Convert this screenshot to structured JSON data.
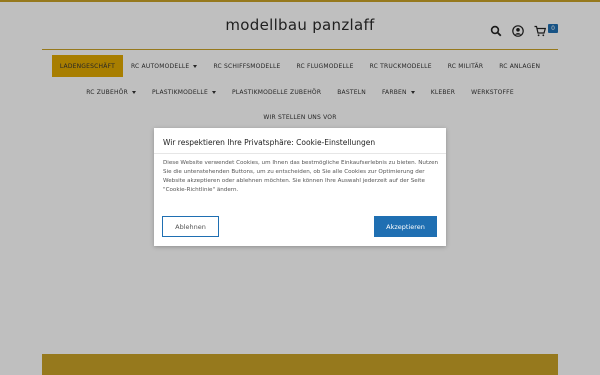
{
  "header": {
    "logo": "modellbau panzlaff",
    "cart_count": "0"
  },
  "icons": {
    "search": "search-icon",
    "account": "account-icon",
    "cart": "cart-icon"
  },
  "colors": {
    "gold": "#c9a227",
    "active_tab": "#e0a900",
    "primary_blue": "#1f6fb2"
  },
  "nav": {
    "row1": [
      {
        "label": "LADENGESCHÄFT",
        "active": true,
        "dropdown": false
      },
      {
        "label": "RC AUTOMODELLE",
        "active": false,
        "dropdown": true
      },
      {
        "label": "RC SCHIFFSMODELLE",
        "active": false,
        "dropdown": false
      },
      {
        "label": "RC FLUGMODELLE",
        "active": false,
        "dropdown": false
      },
      {
        "label": "RC TRUCKMODELLE",
        "active": false,
        "dropdown": false
      },
      {
        "label": "RC MILITÄR",
        "active": false,
        "dropdown": false
      },
      {
        "label": "RC ANLAGEN",
        "active": false,
        "dropdown": false
      }
    ],
    "row2": [
      {
        "label": "RC ZUBEHÖR",
        "dropdown": true
      },
      {
        "label": "PLASTIKMODELLE",
        "dropdown": true
      },
      {
        "label": "PLASTIKMODELLE ZUBEHÖR",
        "dropdown": false
      },
      {
        "label": "BASTELN",
        "dropdown": false
      },
      {
        "label": "FARBEN",
        "dropdown": true
      },
      {
        "label": "KLEBER",
        "dropdown": false
      },
      {
        "label": "WERKSTOFFE",
        "dropdown": false
      }
    ],
    "row3": [
      {
        "label": "WIR STELLEN UNS VOR"
      }
    ]
  },
  "cookie_modal": {
    "title": "Wir respektieren Ihre Privatsphäre: Cookie-Einstellungen",
    "body": "Diese Website verwendet Cookies, um Ihnen das bestmögliche Einkaufserlebnis zu bieten. Nutzen Sie die untenstehenden Buttons, um zu entscheiden, ob Sie alle Cookies zur Optimierung der Website akzeptieren oder ablehnen möchten. Sie können Ihre Auswahl jederzeit auf der Seite \"Cookie-Richtlinie\" ändern.",
    "reject_label": "Ablehnen",
    "accept_label": "Akzeptieren"
  }
}
